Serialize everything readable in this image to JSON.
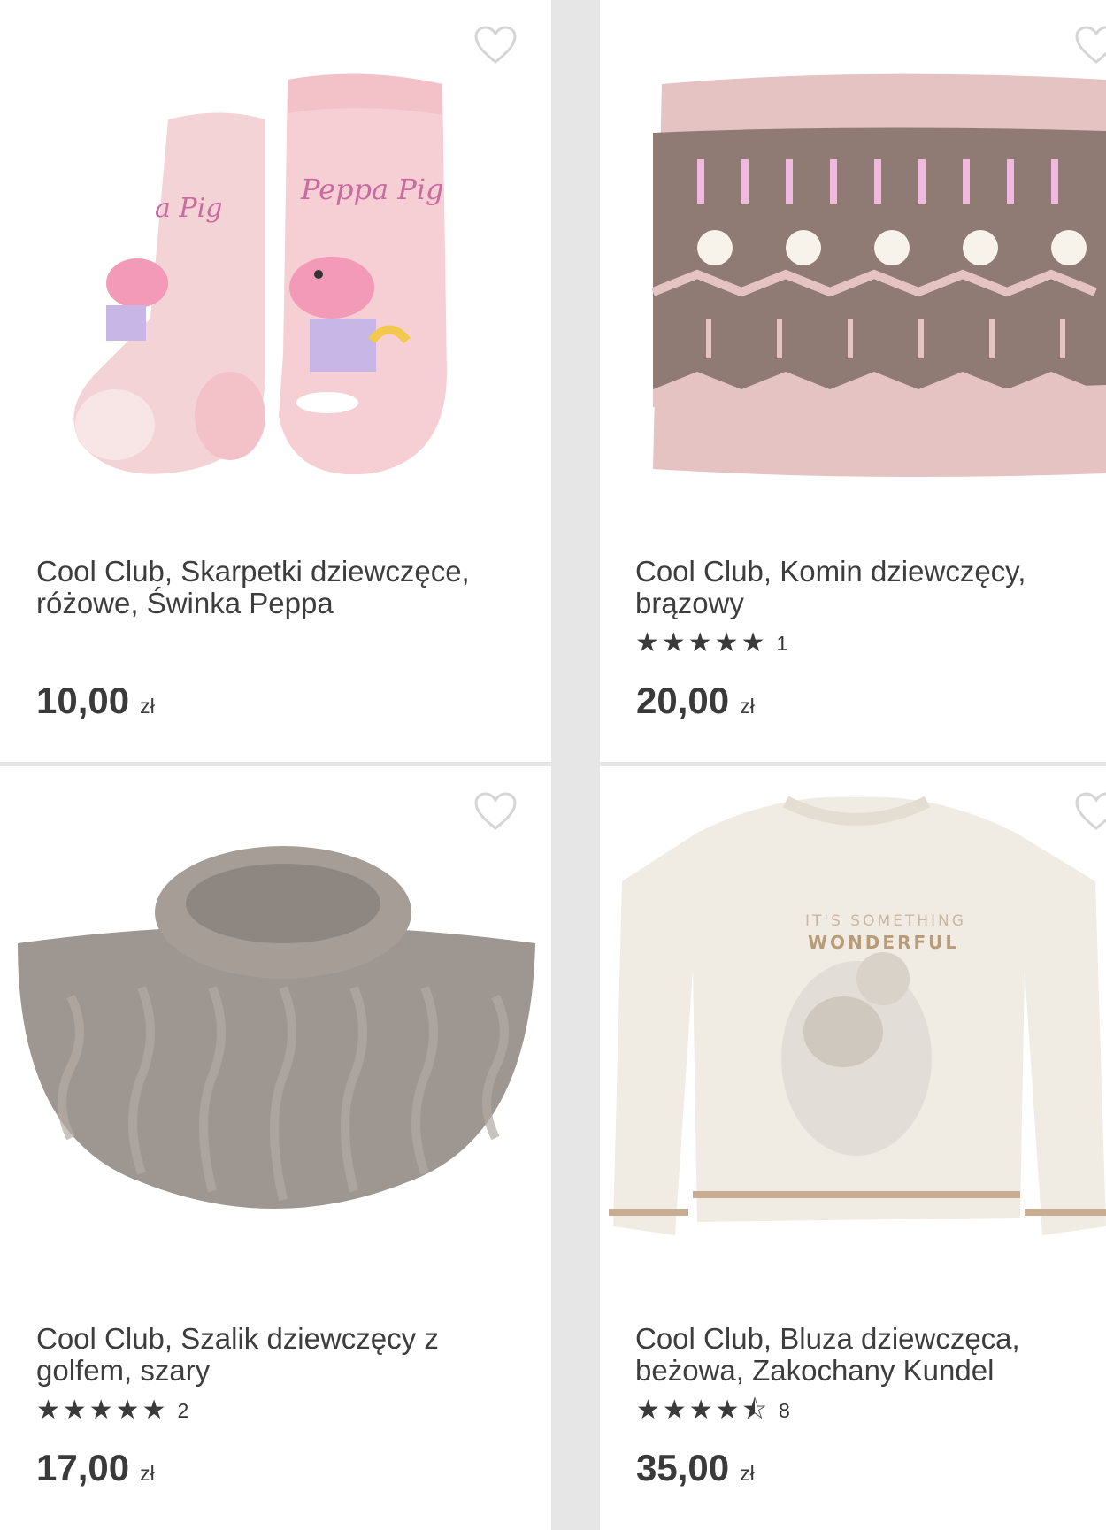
{
  "products": [
    {
      "title": "Cool Club, Skarpetki dziewczęce, różowe, Świnka Peppa",
      "rating_count": "",
      "stars": "",
      "price": "10,00",
      "currency": "zł",
      "image_label": "Peppa Pig"
    },
    {
      "title": "Cool Club, Komin dziewczęcy, brązowy",
      "stars": "★★★★★",
      "rating_count": "1",
      "price": "20,00",
      "currency": "zł"
    },
    {
      "title": "Cool Club, Szalik dziewczęcy z golfem, szary",
      "stars": "★★★★★",
      "rating_count": "2",
      "price": "17,00",
      "currency": "zł"
    },
    {
      "title": "Cool Club, Bluza dziewczęca, beżowa, Zakochany Kundel",
      "stars": "★★★★⯪",
      "rating_count": "8",
      "price": "35,00",
      "currency": "zł",
      "image_label": "IT'S SOMETHING WONDERFUL"
    }
  ],
  "colors": {
    "background": "#e6e6e6",
    "card": "#ffffff",
    "text": "#3a3a3a",
    "sock_pink": "#f2cfd3",
    "knit_brown": "#8f7a74",
    "knit_grey": "#9e9690",
    "sweater_cream": "#f1ece3"
  },
  "icons": [
    "heart-outline-icon",
    "star-icon"
  ]
}
